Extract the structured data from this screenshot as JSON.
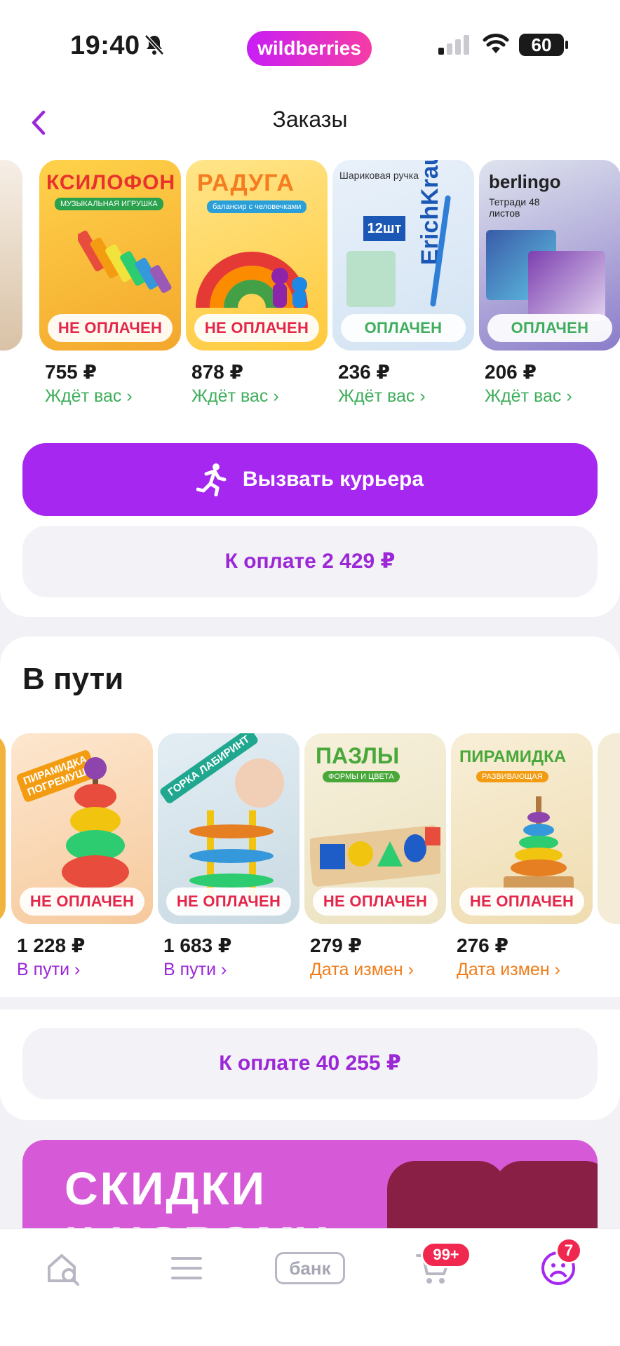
{
  "status_bar": {
    "time": "19:40",
    "brand": "wildberries",
    "battery": "60"
  },
  "header": {
    "title": "Заказы"
  },
  "pending_orders": {
    "items": [
      {
        "badge": "НЕ ОПЛАЧЕН",
        "paid": false,
        "price": "755 ₽",
        "status": "Ждёт вас",
        "image_title": "КСИЛОФОН",
        "image_sub": "МУЗЫКАЛЬНАЯ ИГРУШКА"
      },
      {
        "badge": "НЕ ОПЛАЧЕН",
        "paid": false,
        "price": "878 ₽",
        "status": "Ждёт вас",
        "image_title": "РАДУГА",
        "image_sub": "балансир с человечками"
      },
      {
        "badge": "ОПЛАЧЕН",
        "paid": true,
        "price": "236 ₽",
        "status": "Ждёт вас",
        "image_title": "ErichKrause",
        "image_sub": "Шариковая ручка"
      },
      {
        "badge": "ОПЛАЧЕН",
        "paid": true,
        "price": "206 ₽",
        "status": "Ждёт вас",
        "image_title": "berlingo",
        "image_sub": "Тетради 48 листов"
      }
    ],
    "courier_button": "Вызвать курьера",
    "pay_button": "К оплате 2 429 ₽"
  },
  "in_transit": {
    "title": "В пути",
    "items": [
      {
        "badge": "НЕ ОПЛАЧЕН",
        "price": "1 228 ₽",
        "status": "В пути",
        "status_color": "purple",
        "image_title": "ПИРАМИДКА ПОГРЕМУШКА"
      },
      {
        "badge": "НЕ ОПЛАЧЕН",
        "price": "1 683 ₽",
        "status": "В пути",
        "status_color": "purple",
        "image_title": "ГОРКА ЛАБИРИНТ"
      },
      {
        "badge": "НЕ ОПЛАЧЕН",
        "price": "279 ₽",
        "status": "Дата измен",
        "status_color": "orange",
        "image_title": "ПАЗЛЫ",
        "image_sub": "ФОРМЫ И ЦВЕТА"
      },
      {
        "badge": "НЕ ОПЛАЧЕН",
        "price": "276 ₽",
        "status": "Дата измен",
        "status_color": "orange",
        "image_title": "ПИРАМИДКА",
        "image_sub": "РАЗВИВАЮЩАЯ"
      }
    ],
    "pay_button": "К оплате 40 255 ₽"
  },
  "banner": {
    "line1": "СКИДКИ",
    "line2": "К НОВОМУ"
  },
  "tabbar": {
    "bank_label": "банк",
    "cart_badge": "99+",
    "profile_badge": "7"
  },
  "colors": {
    "accent": "#a527f0",
    "unpaid": "#e3264a",
    "paid": "#3fae5c",
    "status_orange": "#f07d1a"
  }
}
